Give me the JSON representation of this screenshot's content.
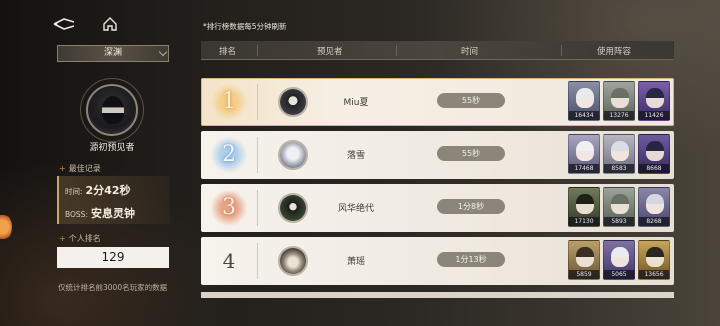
{
  "header": {
    "refresh_note": "*排行榜数据每5分钟刷新",
    "back_icon": "back-arrow-icon",
    "home_icon": "home-icon"
  },
  "sidebar": {
    "tab_label": "深渊",
    "player_title": "源初预见者",
    "best_record_label": "最佳记录",
    "time_label": "时间:",
    "time_value": "2分42秒",
    "boss_label": "BOSS:",
    "boss_value": "安息灵钟",
    "personal_rank_label": "个人排名",
    "personal_rank_value": "129",
    "note": "仅统计排名前3000名玩家的数据"
  },
  "table": {
    "columns": [
      "排名",
      "预见者",
      "时间",
      "使用阵容"
    ],
    "rows": [
      {
        "rank": "1",
        "name": "Miu夏",
        "time": "55秒",
        "team_power": [
          "16434",
          "13276",
          "11426"
        ]
      },
      {
        "rank": "2",
        "name": "落雪",
        "time": "55秒",
        "team_power": [
          "17468",
          "8583",
          "8668"
        ]
      },
      {
        "rank": "3",
        "name": "风华绝代",
        "time": "1分8秒",
        "team_power": [
          "17130",
          "5893",
          "8268"
        ]
      },
      {
        "rank": "4",
        "name": "萧瑶",
        "time": "1分13秒",
        "team_power": [
          "5859",
          "5065",
          "13656"
        ]
      }
    ]
  },
  "colors": {
    "gold": "#e2aa52",
    "silver": "#7fb0e0",
    "bronze": "#d98b68",
    "time_pill": "#8c857a"
  }
}
